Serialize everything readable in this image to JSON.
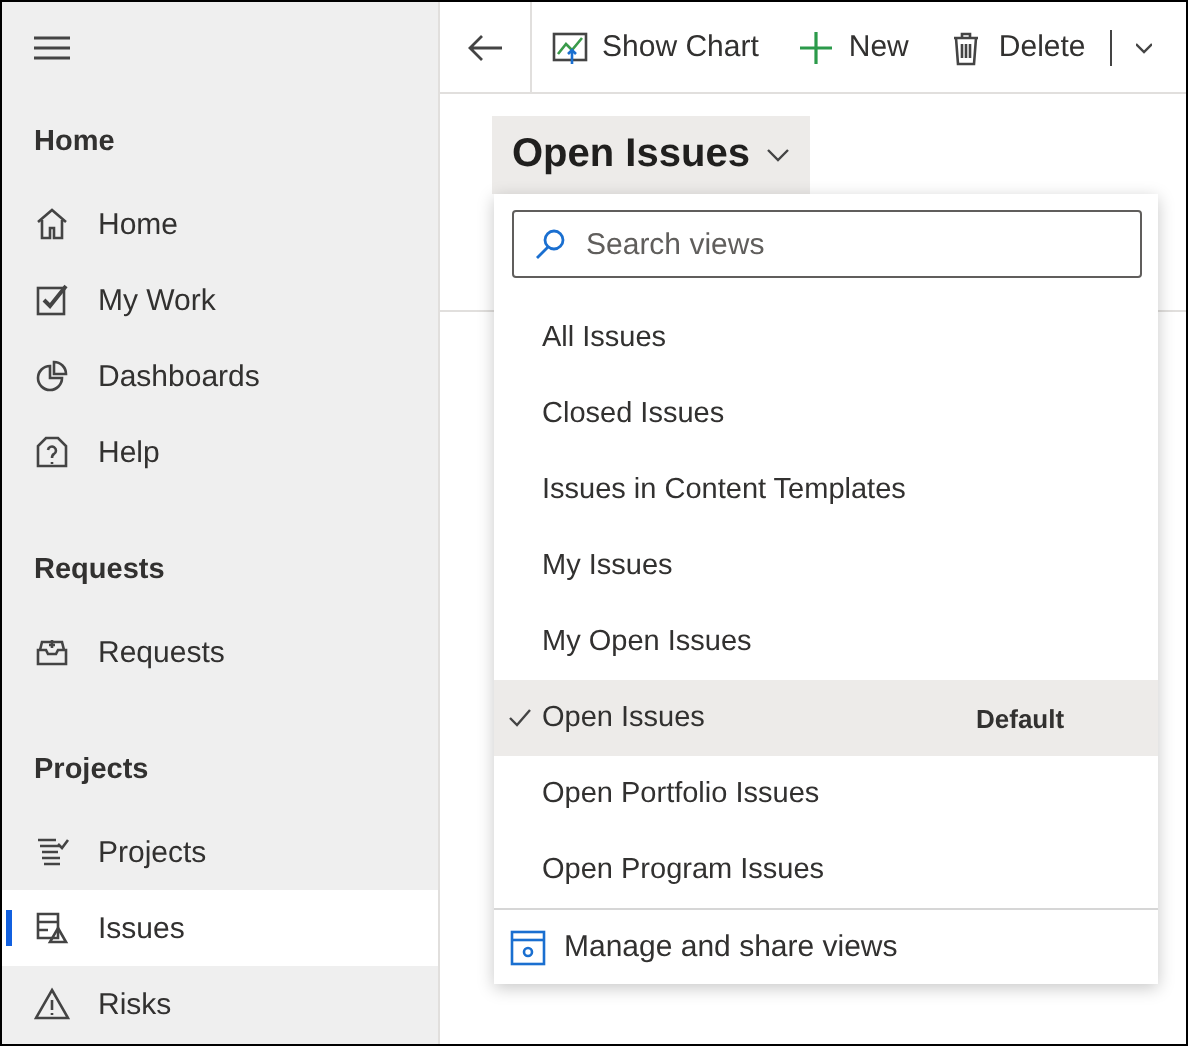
{
  "sidebar": {
    "sections": [
      {
        "title": "Home",
        "items": [
          {
            "label": "Home",
            "selected": false
          },
          {
            "label": "My Work",
            "selected": false
          },
          {
            "label": "Dashboards",
            "selected": false
          },
          {
            "label": "Help",
            "selected": false
          }
        ]
      },
      {
        "title": "Requests",
        "items": [
          {
            "label": "Requests",
            "selected": false
          }
        ]
      },
      {
        "title": "Projects",
        "items": [
          {
            "label": "Projects",
            "selected": false
          },
          {
            "label": "Issues",
            "selected": true
          },
          {
            "label": "Risks",
            "selected": false
          }
        ]
      }
    ]
  },
  "toolbar": {
    "buttons": [
      {
        "label": "Show Chart"
      },
      {
        "label": "New"
      },
      {
        "label": "Delete"
      }
    ]
  },
  "view_selector": {
    "label": "Open Issues",
    "expanded": true
  },
  "views_menu": {
    "search": {
      "placeholder": "Search views"
    },
    "views": [
      {
        "label": "All Issues",
        "selected": false
      },
      {
        "label": "Closed Issues",
        "selected": false
      },
      {
        "label": "Issues in Content Templates",
        "selected": false
      },
      {
        "label": "My Issues",
        "selected": false
      },
      {
        "label": "My Open Issues",
        "selected": false
      },
      {
        "label": "Open Issues",
        "selected": true,
        "badge": "Default"
      },
      {
        "label": "Open Portfolio Issues",
        "selected": false
      },
      {
        "label": "Open Program Issues",
        "selected": false
      }
    ],
    "footer": "Manage and share views"
  }
}
